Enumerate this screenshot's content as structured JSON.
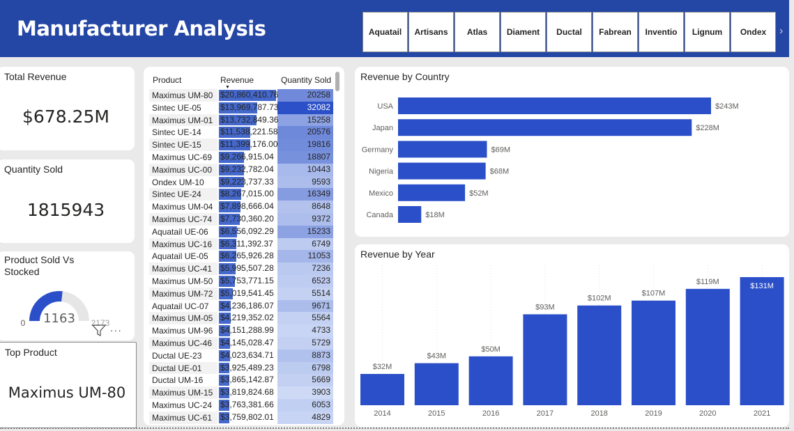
{
  "header": {
    "title": "Manufacturer Analysis",
    "slicer": [
      "Aquatail",
      "Artisans",
      "Atlas",
      "Diament",
      "Ductal",
      "Fabrean",
      "Inventio",
      "Lignum",
      "Ondex"
    ],
    "next_glyph": "›"
  },
  "cards": {
    "total_revenue": {
      "title": "Total Revenue",
      "value": "$678.25M"
    },
    "quantity_sold": {
      "title": "Quantity Sold",
      "value": "1815943"
    },
    "gauge": {
      "title": "Product Sold Vs Stocked",
      "min": "0",
      "value": "1163",
      "max": "2173",
      "fraction": 0.535
    },
    "top_product": {
      "title": "Top Product",
      "value": "Maximus UM-80"
    }
  },
  "table": {
    "columns": [
      "Product",
      "Revenue",
      "Quantity Sold"
    ],
    "rows": [
      {
        "product": "Maximus UM-80",
        "revenue": "$20,860,410.76",
        "qty": "20258",
        "rev_value": 20860410.76,
        "qty_value": 20258
      },
      {
        "product": "Sintec UE-05",
        "revenue": "$13,969,787.73",
        "qty": "32082",
        "rev_value": 13969787.73,
        "qty_value": 32082
      },
      {
        "product": "Maximus UM-01",
        "revenue": "$13,732,849.36",
        "qty": "15258",
        "rev_value": 13732849.36,
        "qty_value": 15258
      },
      {
        "product": "Sintec UE-14",
        "revenue": "$11,538,221.58",
        "qty": "20576",
        "rev_value": 11538221.58,
        "qty_value": 20576
      },
      {
        "product": "Sintec UE-15",
        "revenue": "$11,399,176.00",
        "qty": "19816",
        "rev_value": 11399176.0,
        "qty_value": 19816
      },
      {
        "product": "Maximus UC-69",
        "revenue": "$9,266,915.04",
        "qty": "18807",
        "rev_value": 9266915.04,
        "qty_value": 18807
      },
      {
        "product": "Maximus UC-00",
        "revenue": "$9,232,782.04",
        "qty": "10443",
        "rev_value": 9232782.04,
        "qty_value": 10443
      },
      {
        "product": "Ondex UM-10",
        "revenue": "$9,223,737.33",
        "qty": "9593",
        "rev_value": 9223737.33,
        "qty_value": 9593
      },
      {
        "product": "Sintec UE-24",
        "revenue": "$8,267,015.00",
        "qty": "16349",
        "rev_value": 8267015.0,
        "qty_value": 16349
      },
      {
        "product": "Maximus UM-04",
        "revenue": "$7,898,666.04",
        "qty": "8648",
        "rev_value": 7898666.04,
        "qty_value": 8648
      },
      {
        "product": "Maximus UC-74",
        "revenue": "$7,730,360.20",
        "qty": "9372",
        "rev_value": 7730360.2,
        "qty_value": 9372
      },
      {
        "product": "Aquatail UE-06",
        "revenue": "$6,556,092.29",
        "qty": "15233",
        "rev_value": 6556092.29,
        "qty_value": 15233
      },
      {
        "product": "Maximus UC-16",
        "revenue": "$6,311,392.37",
        "qty": "6749",
        "rev_value": 6311392.37,
        "qty_value": 6749
      },
      {
        "product": "Aquatail UE-05",
        "revenue": "$6,265,926.28",
        "qty": "11053",
        "rev_value": 6265926.28,
        "qty_value": 11053
      },
      {
        "product": "Maximus UC-41",
        "revenue": "$5,995,507.28",
        "qty": "7236",
        "rev_value": 5995507.28,
        "qty_value": 7236
      },
      {
        "product": "Maximus UM-50",
        "revenue": "$5,753,771.15",
        "qty": "6523",
        "rev_value": 5753771.15,
        "qty_value": 6523
      },
      {
        "product": "Maximus UM-72",
        "revenue": "$5,019,541.45",
        "qty": "5514",
        "rev_value": 5019541.45,
        "qty_value": 5514
      },
      {
        "product": "Aquatail UC-07",
        "revenue": "$4,236,186.07",
        "qty": "9671",
        "rev_value": 4236186.07,
        "qty_value": 9671
      },
      {
        "product": "Maximus UM-05",
        "revenue": "$4,219,352.02",
        "qty": "5564",
        "rev_value": 4219352.02,
        "qty_value": 5564
      },
      {
        "product": "Maximus UM-96",
        "revenue": "$4,151,288.99",
        "qty": "4733",
        "rev_value": 4151288.99,
        "qty_value": 4733
      },
      {
        "product": "Maximus UC-46",
        "revenue": "$4,145,028.47",
        "qty": "5729",
        "rev_value": 4145028.47,
        "qty_value": 5729
      },
      {
        "product": "Ductal UE-23",
        "revenue": "$4,023,634.71",
        "qty": "8873",
        "rev_value": 4023634.71,
        "qty_value": 8873
      },
      {
        "product": "Ductal UE-01",
        "revenue": "$3,925,489.23",
        "qty": "6798",
        "rev_value": 3925489.23,
        "qty_value": 6798
      },
      {
        "product": "Ductal UM-16",
        "revenue": "$3,865,142.87",
        "qty": "5669",
        "rev_value": 3865142.87,
        "qty_value": 5669
      },
      {
        "product": "Maximus UM-15",
        "revenue": "$3,819,824.68",
        "qty": "3903",
        "rev_value": 3819824.68,
        "qty_value": 3903
      },
      {
        "product": "Maximus UC-24",
        "revenue": "$3,763,381.66",
        "qty": "6053",
        "rev_value": 3763381.66,
        "qty_value": 6053
      },
      {
        "product": "Maximus UC-61",
        "revenue": "$3,759,802.01",
        "qty": "4829",
        "rev_value": 3759802.01,
        "qty_value": 4829
      }
    ]
  },
  "colors": {
    "bar": "#2b4fc8",
    "header": "#2446a4",
    "rev_bar": "#4468cc"
  },
  "chart_data": [
    {
      "type": "bar",
      "title": "Revenue by Country",
      "orientation": "horizontal",
      "categories": [
        "USA",
        "Japan",
        "Germany",
        "Nigeria",
        "Mexico",
        "Canada"
      ],
      "values": [
        243,
        228,
        69,
        68,
        52,
        18
      ],
      "labels": [
        "$243M",
        "$228M",
        "$69M",
        "$68M",
        "$52M",
        "$18M"
      ],
      "unit": "$M",
      "xlim": [
        0,
        243
      ]
    },
    {
      "type": "bar",
      "title": "Revenue by Year",
      "categories": [
        "2014",
        "2015",
        "2016",
        "2017",
        "2018",
        "2019",
        "2020",
        "2021"
      ],
      "values": [
        32,
        43,
        50,
        93,
        102,
        107,
        119,
        131
      ],
      "labels": [
        "$32M",
        "$43M",
        "$50M",
        "$93M",
        "$102M",
        "$107M",
        "$119M",
        "$131M"
      ],
      "unit": "$M",
      "ylim": [
        0,
        131
      ]
    }
  ]
}
